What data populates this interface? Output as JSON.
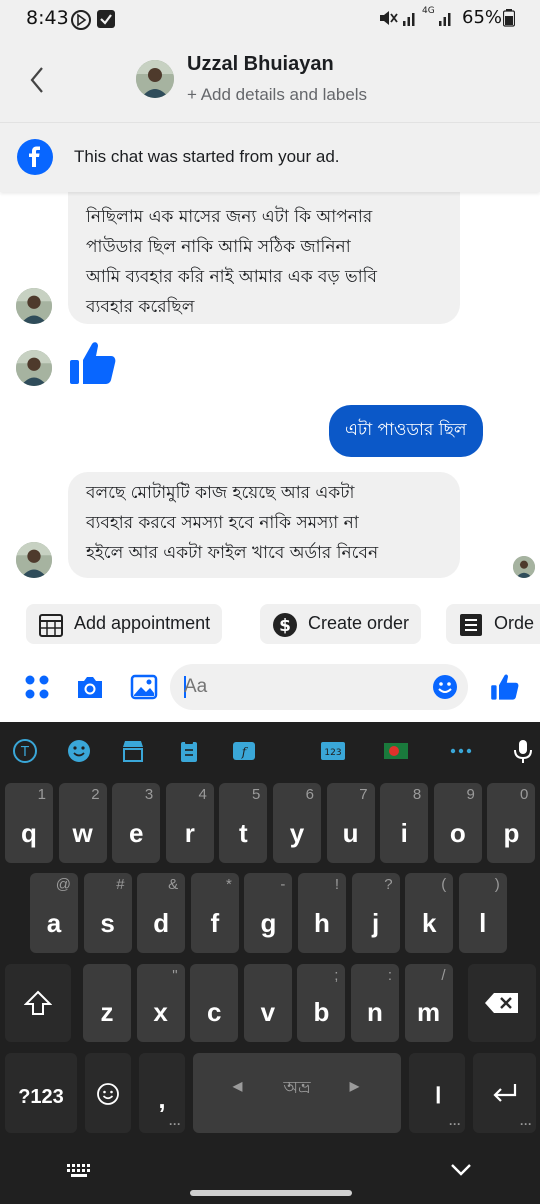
{
  "status": {
    "time": "8:43",
    "battery": "65%",
    "network": "4G"
  },
  "header": {
    "name": "Uzzal Bhuiayan",
    "subtitle": "+ Add details and labels"
  },
  "ad_banner": {
    "text": "This chat was started from your ad."
  },
  "messages": [
    {
      "side": "in",
      "lines": [
        "নিছিলাম এক মাসের জন্য এটা কি আপনার",
        "পাউডার ছিল নাকি আমি সঠিক জানিনা",
        "আমি ব্যবহার করি নাই আমার এক বড় ভাবি",
        "ব্যবহার করেছিল"
      ]
    },
    {
      "side": "in",
      "type": "thumbs-up"
    },
    {
      "side": "out",
      "text": "এটা পাওডার ছিল"
    },
    {
      "side": "in",
      "lines": [
        "বলছে মোটামুটি কাজ হয়েছে আর একটা",
        "ব্যবহার করবে সমস্যা হবে নাকি সমস্যা না",
        "হইলে আর একটা ফাইল খাবে অর্ডার নিবেন"
      ]
    }
  ],
  "quick_actions": [
    "Add appointment",
    "Create order",
    "Orde"
  ],
  "composer": {
    "placeholder": "Aa"
  },
  "keyboard": {
    "row1": [
      {
        "k": "q",
        "h": "1"
      },
      {
        "k": "w",
        "h": "2"
      },
      {
        "k": "e",
        "h": "3"
      },
      {
        "k": "r",
        "h": "4"
      },
      {
        "k": "t",
        "h": "5"
      },
      {
        "k": "y",
        "h": "6"
      },
      {
        "k": "u",
        "h": "7"
      },
      {
        "k": "i",
        "h": "8"
      },
      {
        "k": "o",
        "h": "9"
      },
      {
        "k": "p",
        "h": "0"
      }
    ],
    "row2": [
      {
        "k": "a",
        "h": "@"
      },
      {
        "k": "s",
        "h": "#"
      },
      {
        "k": "d",
        "h": "&"
      },
      {
        "k": "f",
        "h": "*"
      },
      {
        "k": "g",
        "h": "-"
      },
      {
        "k": "h",
        "h": "!"
      },
      {
        "k": "j",
        "h": "?"
      },
      {
        "k": "k",
        "h": "("
      },
      {
        "k": "l",
        "h": ")"
      }
    ],
    "row3": [
      {
        "k": "z",
        "h": ""
      },
      {
        "k": "x",
        "h": "\""
      },
      {
        "k": "c",
        "h": ""
      },
      {
        "k": "v",
        "h": ""
      },
      {
        "k": "b",
        "h": ";"
      },
      {
        "k": "n",
        "h": ":"
      },
      {
        "k": "m",
        "h": "/"
      }
    ],
    "symbols": "?123",
    "comma": ",",
    "space": "অভ্র",
    "period": "।"
  },
  "colors": {
    "messenger_blue": "#0b58c8",
    "bubble_gray": "#f0f0f0",
    "keyboard_bg": "#202020",
    "key_bg": "#3c3c3c"
  }
}
